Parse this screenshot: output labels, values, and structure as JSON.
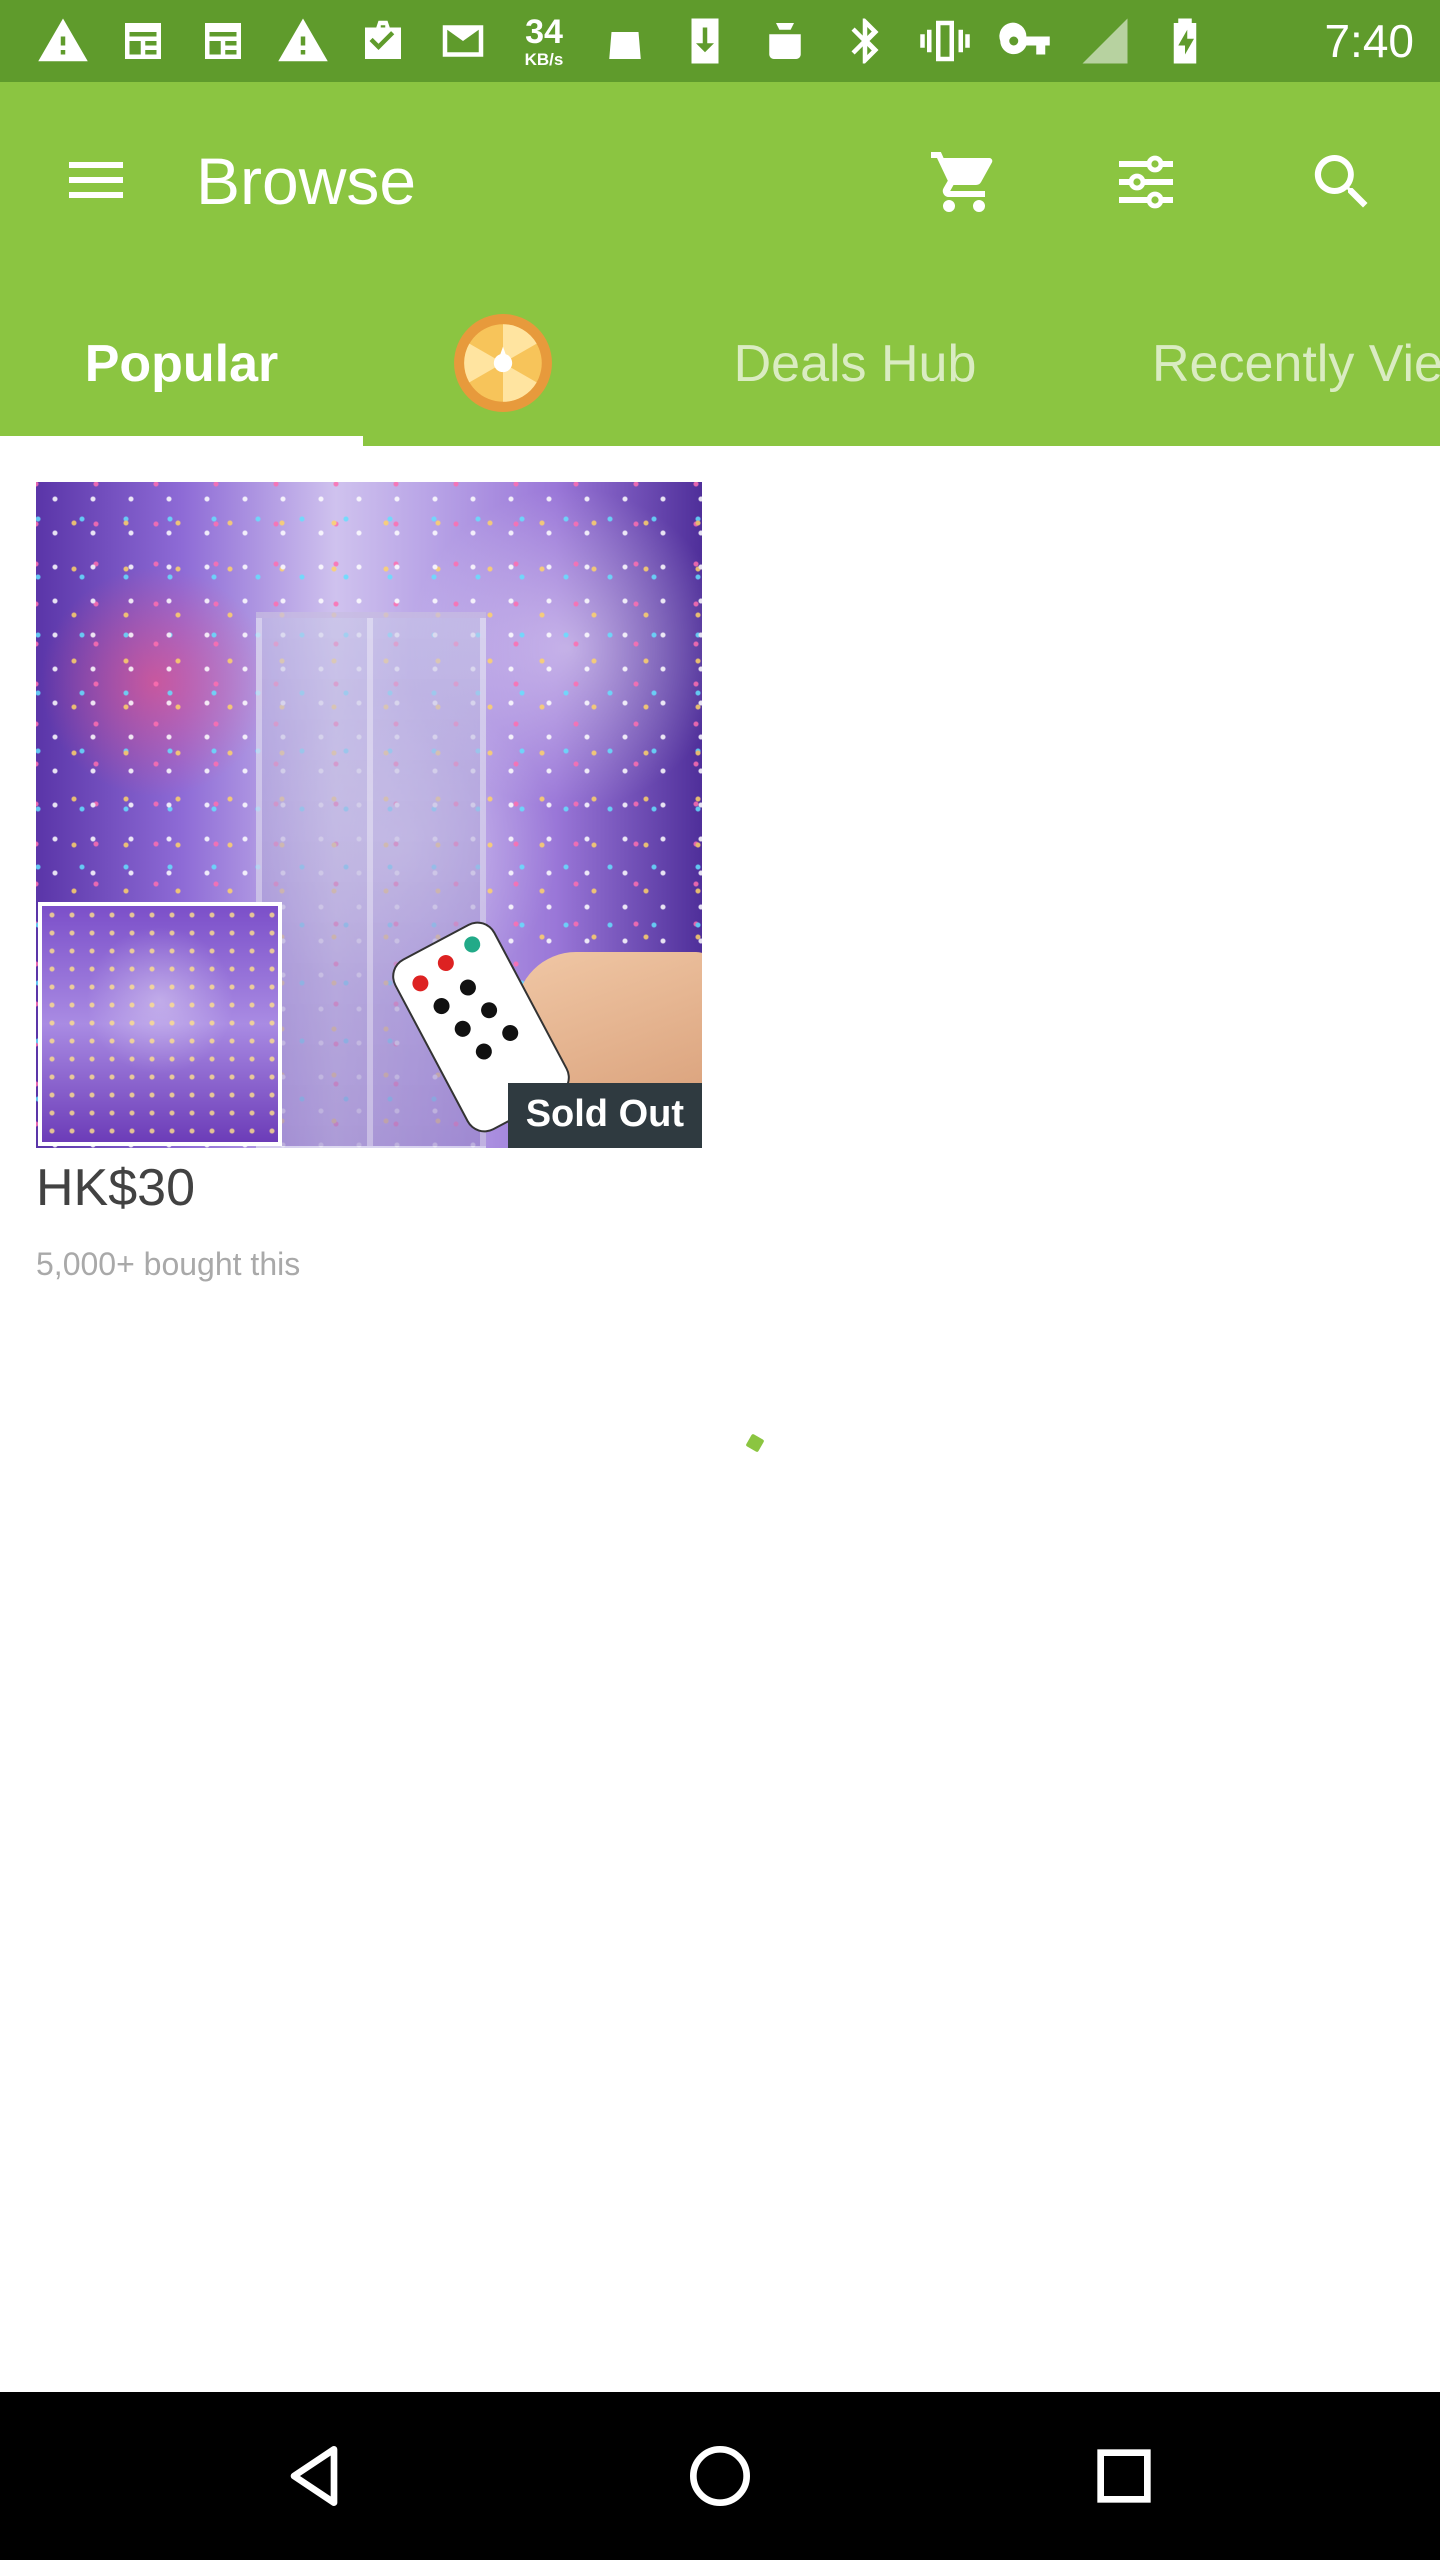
{
  "status_bar": {
    "net_speed_value": "34",
    "net_speed_unit": "KB/s",
    "time": "7:40",
    "icons": [
      "warning-icon",
      "news-icon",
      "news-icon",
      "warning-icon",
      "briefcase-check-icon",
      "gmail-icon",
      "android-icon",
      "download-icon",
      "android-icon",
      "bluetooth-icon",
      "vibrate-icon",
      "vpn-key-icon",
      "no-signal-icon",
      "battery-charging-icon"
    ]
  },
  "app_bar": {
    "title": "Browse",
    "icons": [
      "menu-icon",
      "cart-icon",
      "filter-icon",
      "search-icon"
    ]
  },
  "tabs": [
    {
      "label": "Popular",
      "active": true
    },
    {
      "label": "",
      "icon": "daily-wheel-icon"
    },
    {
      "label": "Deals Hub"
    },
    {
      "label": "Recently Vie"
    }
  ],
  "product": {
    "badge": "Sold Out",
    "price": "HK$30",
    "bought": "5,000+ bought this"
  },
  "colors": {
    "status_bar": "#5f9b2c",
    "app_bar": "#8bc541",
    "badge_bg": "#2f3a40"
  },
  "nav_bar": {
    "icons": [
      "back-icon",
      "home-icon",
      "recents-icon"
    ]
  }
}
